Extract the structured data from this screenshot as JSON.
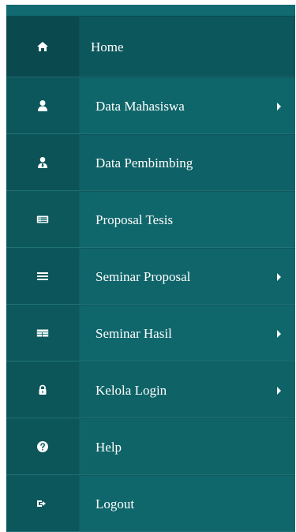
{
  "sidebar": {
    "items": [
      {
        "label": "Home",
        "icon": "home-icon",
        "has_submenu": false
      },
      {
        "label": "Data Mahasiswa",
        "icon": "user-icon",
        "has_submenu": true
      },
      {
        "label": "Data Pembimbing",
        "icon": "user-tie-icon",
        "has_submenu": false
      },
      {
        "label": "Proposal Tesis",
        "icon": "list-card-icon",
        "has_submenu": false
      },
      {
        "label": "Seminar Proposal",
        "icon": "menu-bars-icon",
        "has_submenu": true
      },
      {
        "label": "Seminar Hasil",
        "icon": "table-icon",
        "has_submenu": true
      },
      {
        "label": "Kelola Login",
        "icon": "lock-icon",
        "has_submenu": true
      },
      {
        "label": "Help",
        "icon": "help-icon",
        "has_submenu": false
      },
      {
        "label": "Logout",
        "icon": "logout-icon",
        "has_submenu": false
      }
    ]
  },
  "colors": {
    "background": "#0f5f64",
    "active_background": "#0c575c",
    "text": "#ffffff"
  }
}
